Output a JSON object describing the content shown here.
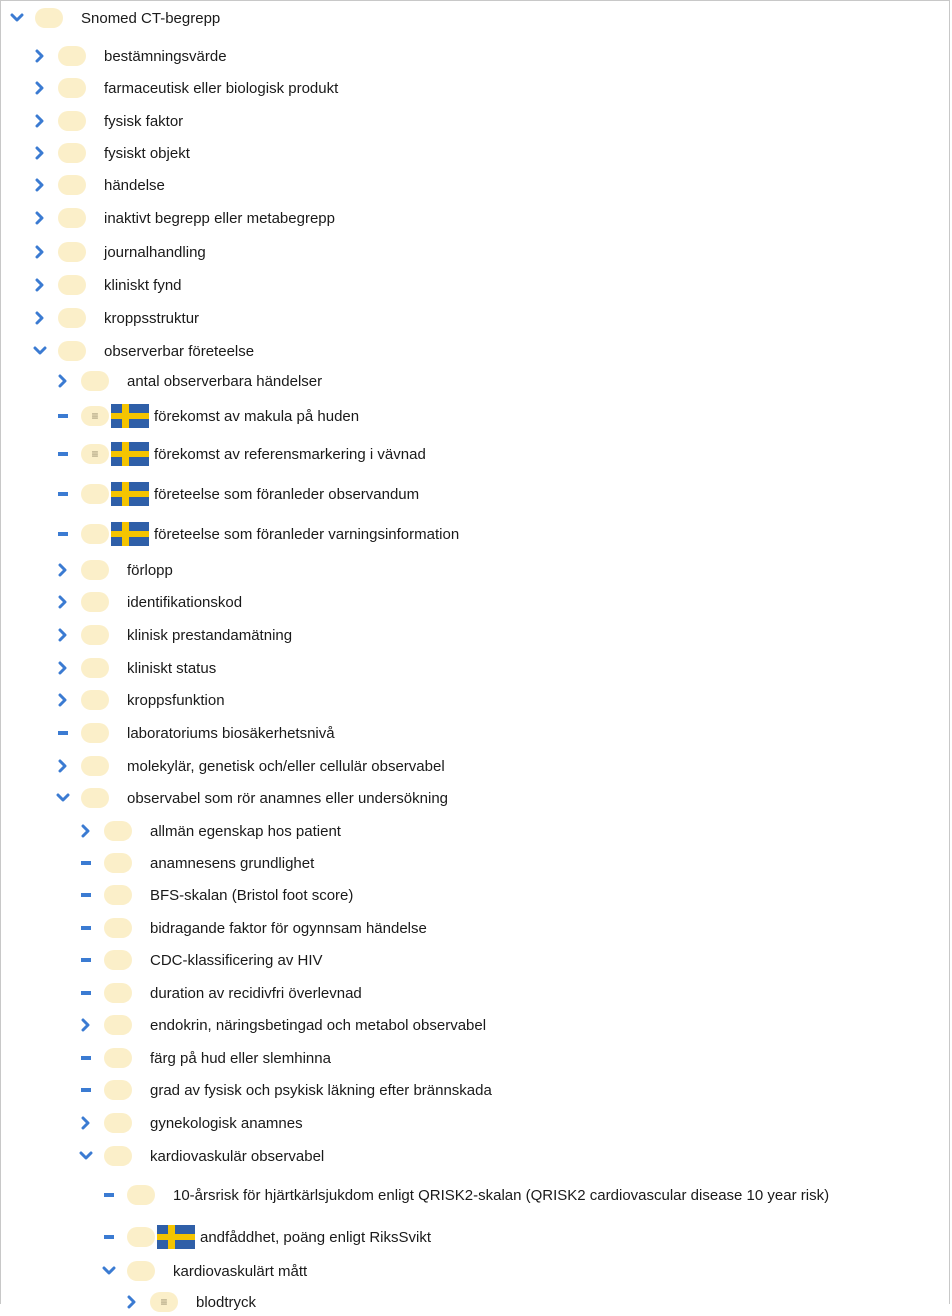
{
  "tree": {
    "nodes": [
      {
        "label": "Snomed CT-begrepp",
        "depth": 0,
        "toggle": "expanded",
        "menu": false,
        "flag": false
      },
      {
        "label": "bestämningsvärde",
        "depth": 1,
        "toggle": "collapsed",
        "menu": false,
        "flag": false
      },
      {
        "label": "farmaceutisk eller biologisk produkt",
        "depth": 1,
        "toggle": "collapsed",
        "menu": false,
        "flag": false
      },
      {
        "label": "fysisk faktor",
        "depth": 1,
        "toggle": "collapsed",
        "menu": false,
        "flag": false
      },
      {
        "label": "fysiskt objekt",
        "depth": 1,
        "toggle": "collapsed",
        "menu": false,
        "flag": false
      },
      {
        "label": "händelse",
        "depth": 1,
        "toggle": "collapsed",
        "menu": false,
        "flag": false
      },
      {
        "label": "inaktivt begrepp eller metabegrepp",
        "depth": 1,
        "toggle": "collapsed",
        "menu": false,
        "flag": false
      },
      {
        "label": "journalhandling",
        "depth": 1,
        "toggle": "collapsed",
        "menu": false,
        "flag": false
      },
      {
        "label": "kliniskt fynd",
        "depth": 1,
        "toggle": "collapsed",
        "menu": false,
        "flag": false
      },
      {
        "label": "kroppsstruktur",
        "depth": 1,
        "toggle": "collapsed",
        "menu": false,
        "flag": false
      },
      {
        "label": "observerbar företeelse",
        "depth": 1,
        "toggle": "expanded",
        "menu": false,
        "flag": false
      },
      {
        "label": "antal observerbara händelser",
        "depth": 2,
        "toggle": "collapsed",
        "menu": false,
        "flag": false
      },
      {
        "label": "förekomst av makula på huden",
        "depth": 2,
        "toggle": "leaf",
        "menu": true,
        "flag": true
      },
      {
        "label": "förekomst av referensmarkering i vävnad",
        "depth": 2,
        "toggle": "leaf",
        "menu": true,
        "flag": true
      },
      {
        "label": "företeelse som föranleder observandum",
        "depth": 2,
        "toggle": "leaf",
        "menu": false,
        "flag": true
      },
      {
        "label": "företeelse som föranleder varningsinformation",
        "depth": 2,
        "toggle": "leaf",
        "menu": false,
        "flag": true
      },
      {
        "label": "förlopp",
        "depth": 2,
        "toggle": "collapsed",
        "menu": false,
        "flag": false
      },
      {
        "label": "identifikationskod",
        "depth": 2,
        "toggle": "collapsed",
        "menu": false,
        "flag": false
      },
      {
        "label": "klinisk prestandamätning",
        "depth": 2,
        "toggle": "collapsed",
        "menu": false,
        "flag": false
      },
      {
        "label": "kliniskt status",
        "depth": 2,
        "toggle": "collapsed",
        "menu": false,
        "flag": false
      },
      {
        "label": "kroppsfunktion",
        "depth": 2,
        "toggle": "collapsed",
        "menu": false,
        "flag": false
      },
      {
        "label": "laboratoriums biosäkerhetsnivå",
        "depth": 2,
        "toggle": "leaf",
        "menu": false,
        "flag": false
      },
      {
        "label": "molekylär, genetisk och/eller cellulär observabel",
        "depth": 2,
        "toggle": "collapsed",
        "menu": false,
        "flag": false
      },
      {
        "label": "observabel som rör anamnes eller undersökning",
        "depth": 2,
        "toggle": "expanded",
        "menu": false,
        "flag": false
      },
      {
        "label": "allmän egenskap hos patient",
        "depth": 3,
        "toggle": "collapsed",
        "menu": false,
        "flag": false
      },
      {
        "label": "anamnesens grundlighet",
        "depth": 3,
        "toggle": "leaf",
        "menu": false,
        "flag": false
      },
      {
        "label": "BFS-skalan (Bristol foot score)",
        "depth": 3,
        "toggle": "leaf",
        "menu": false,
        "flag": false
      },
      {
        "label": "bidragande faktor för ogynnsam händelse",
        "depth": 3,
        "toggle": "leaf",
        "menu": false,
        "flag": false
      },
      {
        "label": "CDC-klassificering av HIV",
        "depth": 3,
        "toggle": "leaf",
        "menu": false,
        "flag": false
      },
      {
        "label": "duration av recidivfri överlevnad",
        "depth": 3,
        "toggle": "leaf",
        "menu": false,
        "flag": false
      },
      {
        "label": "endokrin, näringsbetingad och metabol observabel",
        "depth": 3,
        "toggle": "collapsed",
        "menu": false,
        "flag": false
      },
      {
        "label": "färg på hud eller slemhinna",
        "depth": 3,
        "toggle": "leaf",
        "menu": false,
        "flag": false
      },
      {
        "label": "grad av fysisk och psykisk läkning efter brännskada",
        "depth": 3,
        "toggle": "leaf",
        "menu": false,
        "flag": false
      },
      {
        "label": "gynekologisk anamnes",
        "depth": 3,
        "toggle": "collapsed",
        "menu": false,
        "flag": false
      },
      {
        "label": "kardiovaskulär observabel",
        "depth": 3,
        "toggle": "expanded",
        "menu": false,
        "flag": false
      },
      {
        "label": "10-årsrisk för hjärtkärlsjukdom enligt QRISK2-skalan (QRISK2 cardiovascular disease 10 year risk)",
        "depth": 4,
        "toggle": "leaf",
        "menu": false,
        "flag": false
      },
      {
        "label": "andfåddhet, poäng enligt RiksSvikt",
        "depth": 4,
        "toggle": "leaf",
        "menu": false,
        "flag": true
      },
      {
        "label": "kardiovaskulärt mått",
        "depth": 4,
        "toggle": "expanded",
        "menu": false,
        "flag": false
      },
      {
        "label": "blodtryck",
        "depth": 5,
        "toggle": "collapsed",
        "menu": true,
        "flag": false
      }
    ]
  },
  "icons": {
    "expanded": "chevron-down-icon",
    "collapsed": "chevron-right-icon",
    "leaf": "dash-icon",
    "node": "concept-node-icon",
    "menu": "menu-lines-icon",
    "flag": "swedish-flag-icon"
  },
  "colors": {
    "toggle": "#3b7bd2",
    "node_fill": "#fbefc9",
    "flag_blue": "#2f5fa8",
    "flag_yellow": "#f4c400"
  }
}
